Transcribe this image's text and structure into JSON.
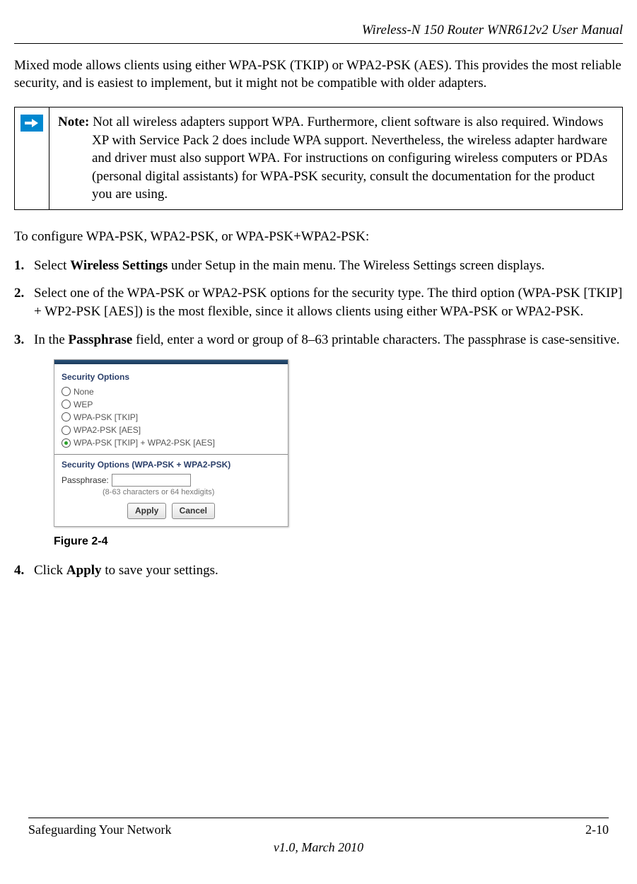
{
  "header": {
    "title": "Wireless-N 150 Router WNR612v2 User Manual"
  },
  "intro": "Mixed mode allows clients using either WPA-PSK (TKIP) or WPA2-PSK (AES). This provides the most reliable security, and is easiest to implement, but it might not be compatible with older adapters.",
  "note": {
    "label": "Note:",
    "body": "Not all wireless adapters support WPA. Furthermore, client software is also required. Windows XP with Service Pack 2 does include WPA support. Nevertheless, the wireless adapter hardware and driver must also support WPA. For instructions on configuring wireless computers or PDAs (personal digital assistants) for WPA-PSK security, consult the documentation for the product you are using."
  },
  "subhead": "To configure WPA-PSK, WPA2-PSK, or WPA-PSK+WPA2-PSK:",
  "steps": {
    "s1_num": "1.",
    "s1_pre": "Select ",
    "s1_bold": "Wireless Settings",
    "s1_post": " under Setup in the main menu. The Wireless Settings screen displays.",
    "s2_num": "2.",
    "s2_text": "Select one of the WPA-PSK or WPA2-PSK options for the security type. The third option (WPA-PSK [TKIP] + WP2-PSK [AES]) is the most flexible, since it allows clients using either WPA-PSK or WPA2-PSK.",
    "s3_num": "3.",
    "s3_pre": "In the ",
    "s3_bold": "Passphrase",
    "s3_post": " field, enter a word or group of 8–63 printable characters. The passphrase is case-sensitive.",
    "s4_num": "4.",
    "s4_pre": "Click ",
    "s4_bold": "Apply",
    "s4_post": " to save your settings."
  },
  "figure": {
    "caption": "Figure 2-4",
    "section1": "Security Options",
    "opt_none": "None",
    "opt_wep": "WEP",
    "opt_wpa": "WPA-PSK [TKIP]",
    "opt_wpa2": "WPA2-PSK [AES]",
    "opt_mixed": "WPA-PSK [TKIP] + WPA2-PSK [AES]",
    "section2": "Security Options (WPA-PSK + WPA2-PSK)",
    "pass_label": "Passphrase:",
    "hint": "(8-63 characters or 64 hexdigits)",
    "apply": "Apply",
    "cancel": "Cancel"
  },
  "footer": {
    "left": "Safeguarding Your Network",
    "right": "2-10",
    "version": "v1.0, March 2010"
  }
}
